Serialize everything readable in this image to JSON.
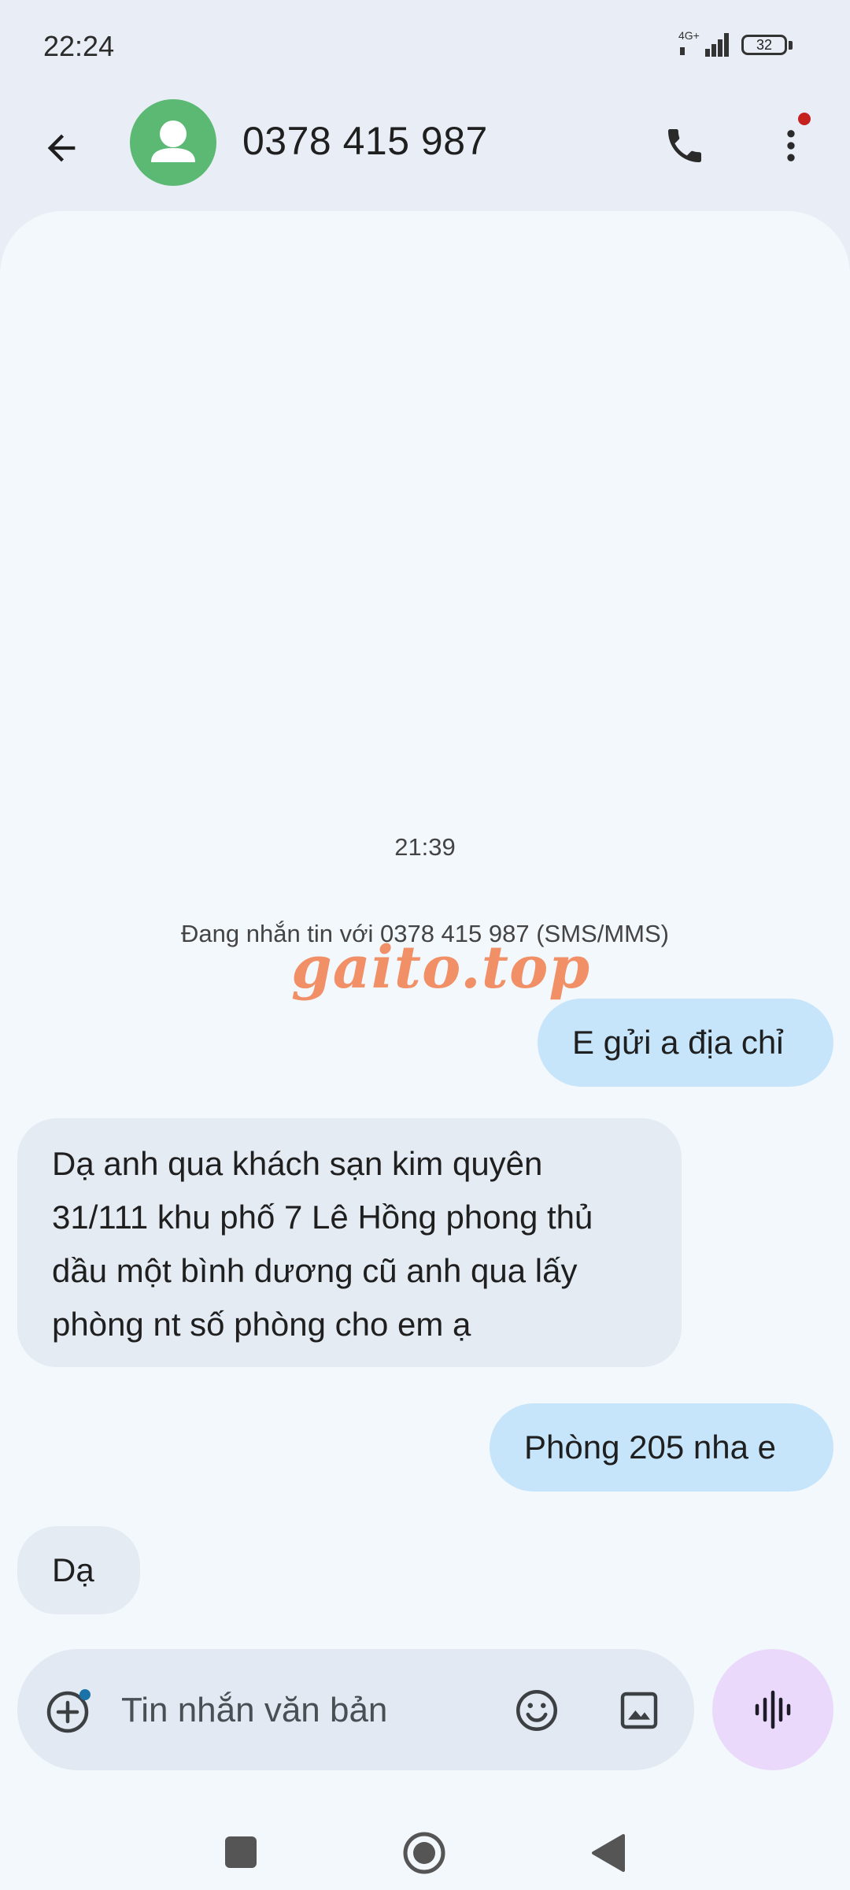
{
  "status_bar": {
    "time": "22:24",
    "network": "4G+",
    "battery": "32"
  },
  "header": {
    "contact": "0378 415 987"
  },
  "conversation": {
    "timestamp": "21:39",
    "info": "Đang nhắn tin với 0378 415 987 (SMS/MMS)",
    "watermark": "gaito.top",
    "messages": [
      {
        "direction": "outgoing",
        "text": "E gửi a địa chỉ"
      },
      {
        "direction": "incoming",
        "text": "Dạ anh qua khách sạn kim quyên 31/111 khu phố 7 Lê Hồng phong thủ dầu một bình dương cũ anh qua lấy phòng nt số phòng cho em ạ"
      },
      {
        "direction": "outgoing",
        "text": "Phòng 205 nha e"
      },
      {
        "direction": "incoming",
        "text": "Dạ"
      }
    ]
  },
  "compose": {
    "placeholder": "Tin nhắn văn bản"
  },
  "colors": {
    "avatar": "#5bb974",
    "outgoing_bubble": "#c6e5fb",
    "incoming_bubble": "#e4ebf3",
    "voice_button": "#ead9fb",
    "notification_dot": "#c5221f"
  }
}
